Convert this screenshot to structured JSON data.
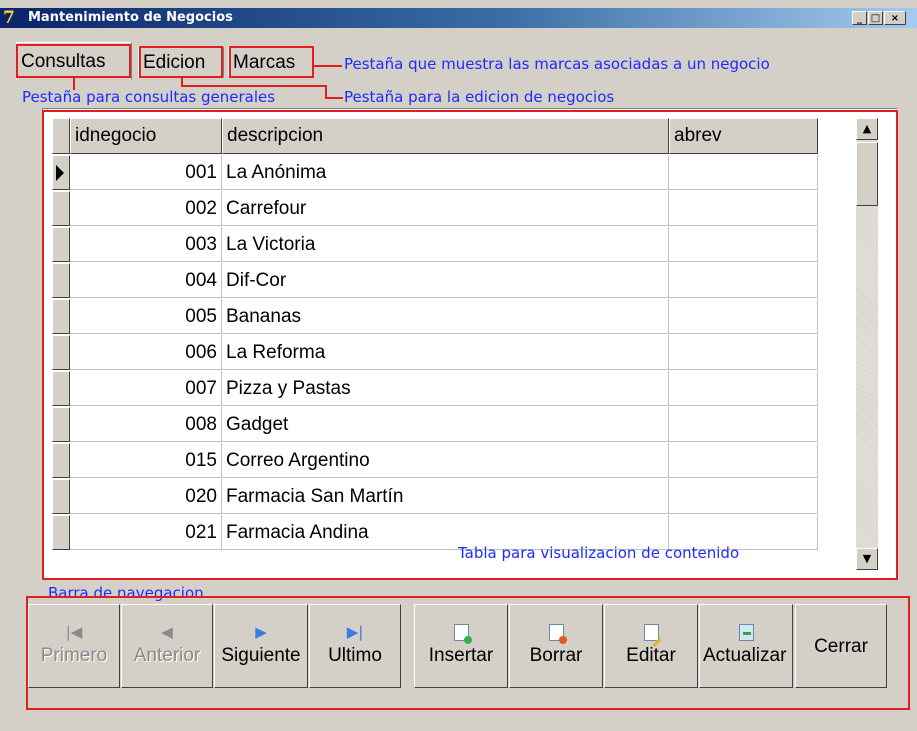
{
  "window": {
    "title": "Mantenimiento de Negocios",
    "icon": "7",
    "controls": [
      "_",
      "□",
      "×"
    ]
  },
  "tabs": [
    {
      "label": "Consultas",
      "active": true
    },
    {
      "label": "Edicion",
      "active": false
    },
    {
      "label": "Marcas",
      "active": false
    }
  ],
  "annotations": {
    "marcas": "Pestaña que muestra las marcas asociadas a un negocio",
    "consultas": "Pestaña para consultas generales",
    "edicion": "Pestaña para la edicion de negocios",
    "tabla": "Tabla para visualizacion de contenido",
    "barra": "Barra de navegacion"
  },
  "grid": {
    "columns": [
      "idnegocio",
      "descripcion",
      "abrev"
    ],
    "rows": [
      {
        "id": "001",
        "desc": "La Anónima",
        "abrev": ""
      },
      {
        "id": "002",
        "desc": "Carrefour",
        "abrev": ""
      },
      {
        "id": "003",
        "desc": "La Victoria",
        "abrev": ""
      },
      {
        "id": "004",
        "desc": "Dif-Cor",
        "abrev": ""
      },
      {
        "id": "005",
        "desc": "Bananas",
        "abrev": ""
      },
      {
        "id": "006",
        "desc": "La Reforma",
        "abrev": ""
      },
      {
        "id": "007",
        "desc": "Pizza y Pastas",
        "abrev": ""
      },
      {
        "id": "008",
        "desc": "Gadget",
        "abrev": ""
      },
      {
        "id": "015",
        "desc": "Correo Argentino",
        "abrev": ""
      },
      {
        "id": "020",
        "desc": "Farmacia San Martín",
        "abrev": ""
      },
      {
        "id": "021",
        "desc": "Farmacia Andina",
        "abrev": ""
      }
    ]
  },
  "nav": {
    "primero": "Primero",
    "anterior": "Anterior",
    "siguiente": "Siguiente",
    "ultimo": "Ultimo",
    "insertar": "Insertar",
    "borrar": "Borrar",
    "editar": "Editar",
    "actualizar": "Actualizar",
    "cerrar": "Cerrar"
  },
  "colors": {
    "annotation_text": "#1d2bff",
    "annotation_line": "#e02020",
    "titlebar": "#0a246a"
  }
}
